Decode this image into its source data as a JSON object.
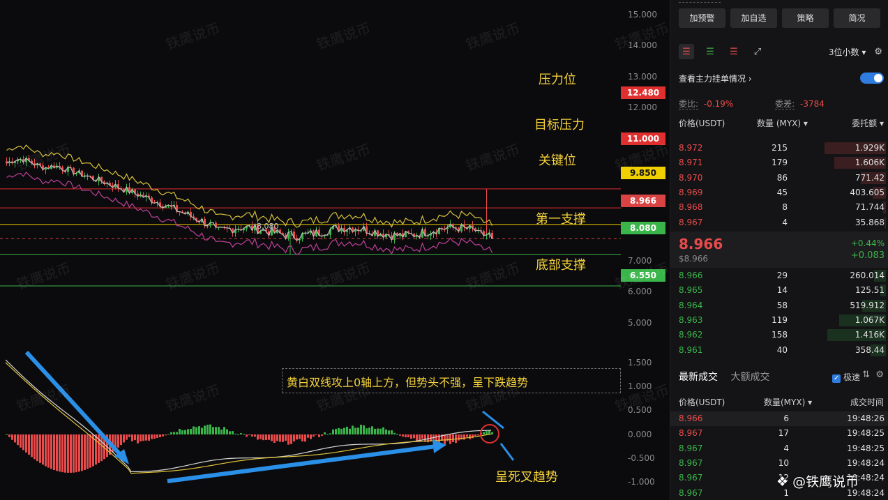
{
  "watermark_text": "铁鹰说币",
  "logo_watermark": "❖ @铁鹰说币",
  "price_axis": [
    "15.000",
    "14.000",
    "13.000",
    "12.000",
    "7.000",
    "6.000",
    "5.000"
  ],
  "macd_axis": [
    "1.500",
    "1.000",
    "0.500",
    "0.000",
    "-0.500",
    "-1.000"
  ],
  "levels": {
    "resistance": {
      "label": "压力位",
      "price": "12.480",
      "color": "#e02f2f"
    },
    "target_resistance": {
      "label": "目标压力",
      "price": "11.000",
      "color": "#e02f2f"
    },
    "key": {
      "label": "关键位",
      "price": "9.850",
      "color": "#f0d000"
    },
    "current": {
      "price": "8.966",
      "color": "#d94343"
    },
    "first_support": {
      "label": "第一支撑",
      "price": "8.080",
      "color": "#39b54a"
    },
    "bottom_support": {
      "label": "底部支撑",
      "price": "6.550",
      "color": "#39b54a"
    }
  },
  "low_marker": "8.080",
  "macd_note": "黄白双线攻上0轴上方，但势头不强，呈下跌趋势",
  "death_cross_note": "呈死叉趋势",
  "panel": {
    "buttons": [
      "加预警",
      "加自选",
      "策略",
      "简况"
    ],
    "precision": "3位小数",
    "main_orders_label": "查看主力挂单情况",
    "ratio_label": "委比:",
    "ratio_value": "-0.19%",
    "diff_label": "委差:",
    "diff_value": "-3784",
    "book_headers": {
      "price": "价格(USDT)",
      "qty": "数量 (MYX)",
      "amount": "委托额"
    },
    "asks": [
      {
        "price": "8.972",
        "qty": "215",
        "amount": "1.929K",
        "depth": 0.42
      },
      {
        "price": "8.971",
        "qty": "179",
        "amount": "1.606K",
        "depth": 0.35
      },
      {
        "price": "8.970",
        "qty": "86",
        "amount": "771.42",
        "depth": 0.17
      },
      {
        "price": "8.969",
        "qty": "45",
        "amount": "403.605",
        "depth": 0.09
      },
      {
        "price": "8.968",
        "qty": "8",
        "amount": "71.744",
        "depth": 0.02
      },
      {
        "price": "8.967",
        "qty": "4",
        "amount": "35.868",
        "depth": 0.01
      }
    ],
    "last_price": "8.966",
    "last_price_usd": "$8.966",
    "change_pct": "+0.44%",
    "change_abs": "+0.083",
    "bids": [
      {
        "price": "8.966",
        "qty": "29",
        "amount": "260.014",
        "depth": 0.06
      },
      {
        "price": "8.965",
        "qty": "14",
        "amount": "125.51",
        "depth": 0.03
      },
      {
        "price": "8.964",
        "qty": "58",
        "amount": "519.912",
        "depth": 0.12
      },
      {
        "price": "8.963",
        "qty": "119",
        "amount": "1.067K",
        "depth": 0.24
      },
      {
        "price": "8.962",
        "qty": "158",
        "amount": "1.416K",
        "depth": 0.3
      },
      {
        "price": "8.961",
        "qty": "40",
        "amount": "358.44",
        "depth": 0.08
      }
    ],
    "trade_tabs": [
      "最新成交",
      "大额成交"
    ],
    "fast_label": "极速",
    "trade_headers": {
      "price": "价格(USDT)",
      "qty": "数量(MYX)",
      "time": "成交时间"
    },
    "trades": [
      {
        "price": "8.966",
        "qty": "6",
        "time": "19:48:26",
        "side": "sell"
      },
      {
        "price": "8.967",
        "qty": "17",
        "time": "19:48:25",
        "side": "sell"
      },
      {
        "price": "8.967",
        "qty": "4",
        "time": "19:48:25",
        "side": "buy"
      },
      {
        "price": "8.967",
        "qty": "10",
        "time": "19:48:24",
        "side": "buy"
      },
      {
        "price": "8.967",
        "qty": "12",
        "time": "19:48:24",
        "side": "buy"
      },
      {
        "price": "8.967",
        "qty": "1",
        "time": "19:48:24",
        "side": "buy"
      }
    ]
  },
  "colors": {
    "up": "#3bb54a",
    "down": "#e84b4b",
    "accent": "#2f7de1",
    "annotation": "#f4d23b"
  }
}
